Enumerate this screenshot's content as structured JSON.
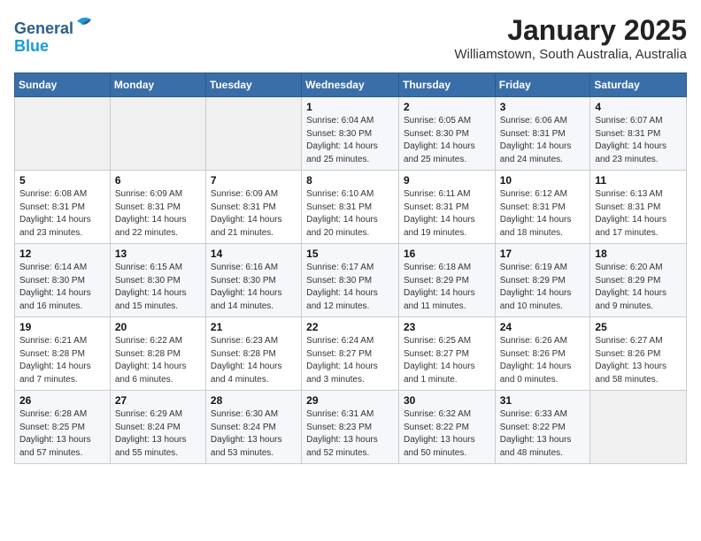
{
  "header": {
    "logo_line1": "General",
    "logo_line2": "Blue",
    "month_title": "January 2025",
    "location": "Williamstown, South Australia, Australia"
  },
  "weekdays": [
    "Sunday",
    "Monday",
    "Tuesday",
    "Wednesday",
    "Thursday",
    "Friday",
    "Saturday"
  ],
  "weeks": [
    [
      {
        "day": "",
        "info": ""
      },
      {
        "day": "",
        "info": ""
      },
      {
        "day": "",
        "info": ""
      },
      {
        "day": "1",
        "info": "Sunrise: 6:04 AM\nSunset: 8:30 PM\nDaylight: 14 hours\nand 25 minutes."
      },
      {
        "day": "2",
        "info": "Sunrise: 6:05 AM\nSunset: 8:30 PM\nDaylight: 14 hours\nand 25 minutes."
      },
      {
        "day": "3",
        "info": "Sunrise: 6:06 AM\nSunset: 8:31 PM\nDaylight: 14 hours\nand 24 minutes."
      },
      {
        "day": "4",
        "info": "Sunrise: 6:07 AM\nSunset: 8:31 PM\nDaylight: 14 hours\nand 23 minutes."
      }
    ],
    [
      {
        "day": "5",
        "info": "Sunrise: 6:08 AM\nSunset: 8:31 PM\nDaylight: 14 hours\nand 23 minutes."
      },
      {
        "day": "6",
        "info": "Sunrise: 6:09 AM\nSunset: 8:31 PM\nDaylight: 14 hours\nand 22 minutes."
      },
      {
        "day": "7",
        "info": "Sunrise: 6:09 AM\nSunset: 8:31 PM\nDaylight: 14 hours\nand 21 minutes."
      },
      {
        "day": "8",
        "info": "Sunrise: 6:10 AM\nSunset: 8:31 PM\nDaylight: 14 hours\nand 20 minutes."
      },
      {
        "day": "9",
        "info": "Sunrise: 6:11 AM\nSunset: 8:31 PM\nDaylight: 14 hours\nand 19 minutes."
      },
      {
        "day": "10",
        "info": "Sunrise: 6:12 AM\nSunset: 8:31 PM\nDaylight: 14 hours\nand 18 minutes."
      },
      {
        "day": "11",
        "info": "Sunrise: 6:13 AM\nSunset: 8:31 PM\nDaylight: 14 hours\nand 17 minutes."
      }
    ],
    [
      {
        "day": "12",
        "info": "Sunrise: 6:14 AM\nSunset: 8:30 PM\nDaylight: 14 hours\nand 16 minutes."
      },
      {
        "day": "13",
        "info": "Sunrise: 6:15 AM\nSunset: 8:30 PM\nDaylight: 14 hours\nand 15 minutes."
      },
      {
        "day": "14",
        "info": "Sunrise: 6:16 AM\nSunset: 8:30 PM\nDaylight: 14 hours\nand 14 minutes."
      },
      {
        "day": "15",
        "info": "Sunrise: 6:17 AM\nSunset: 8:30 PM\nDaylight: 14 hours\nand 12 minutes."
      },
      {
        "day": "16",
        "info": "Sunrise: 6:18 AM\nSunset: 8:29 PM\nDaylight: 14 hours\nand 11 minutes."
      },
      {
        "day": "17",
        "info": "Sunrise: 6:19 AM\nSunset: 8:29 PM\nDaylight: 14 hours\nand 10 minutes."
      },
      {
        "day": "18",
        "info": "Sunrise: 6:20 AM\nSunset: 8:29 PM\nDaylight: 14 hours\nand 9 minutes."
      }
    ],
    [
      {
        "day": "19",
        "info": "Sunrise: 6:21 AM\nSunset: 8:28 PM\nDaylight: 14 hours\nand 7 minutes."
      },
      {
        "day": "20",
        "info": "Sunrise: 6:22 AM\nSunset: 8:28 PM\nDaylight: 14 hours\nand 6 minutes."
      },
      {
        "day": "21",
        "info": "Sunrise: 6:23 AM\nSunset: 8:28 PM\nDaylight: 14 hours\nand 4 minutes."
      },
      {
        "day": "22",
        "info": "Sunrise: 6:24 AM\nSunset: 8:27 PM\nDaylight: 14 hours\nand 3 minutes."
      },
      {
        "day": "23",
        "info": "Sunrise: 6:25 AM\nSunset: 8:27 PM\nDaylight: 14 hours\nand 1 minute."
      },
      {
        "day": "24",
        "info": "Sunrise: 6:26 AM\nSunset: 8:26 PM\nDaylight: 14 hours\nand 0 minutes."
      },
      {
        "day": "25",
        "info": "Sunrise: 6:27 AM\nSunset: 8:26 PM\nDaylight: 13 hours\nand 58 minutes."
      }
    ],
    [
      {
        "day": "26",
        "info": "Sunrise: 6:28 AM\nSunset: 8:25 PM\nDaylight: 13 hours\nand 57 minutes."
      },
      {
        "day": "27",
        "info": "Sunrise: 6:29 AM\nSunset: 8:24 PM\nDaylight: 13 hours\nand 55 minutes."
      },
      {
        "day": "28",
        "info": "Sunrise: 6:30 AM\nSunset: 8:24 PM\nDaylight: 13 hours\nand 53 minutes."
      },
      {
        "day": "29",
        "info": "Sunrise: 6:31 AM\nSunset: 8:23 PM\nDaylight: 13 hours\nand 52 minutes."
      },
      {
        "day": "30",
        "info": "Sunrise: 6:32 AM\nSunset: 8:22 PM\nDaylight: 13 hours\nand 50 minutes."
      },
      {
        "day": "31",
        "info": "Sunrise: 6:33 AM\nSunset: 8:22 PM\nDaylight: 13 hours\nand 48 minutes."
      },
      {
        "day": "",
        "info": ""
      }
    ]
  ]
}
